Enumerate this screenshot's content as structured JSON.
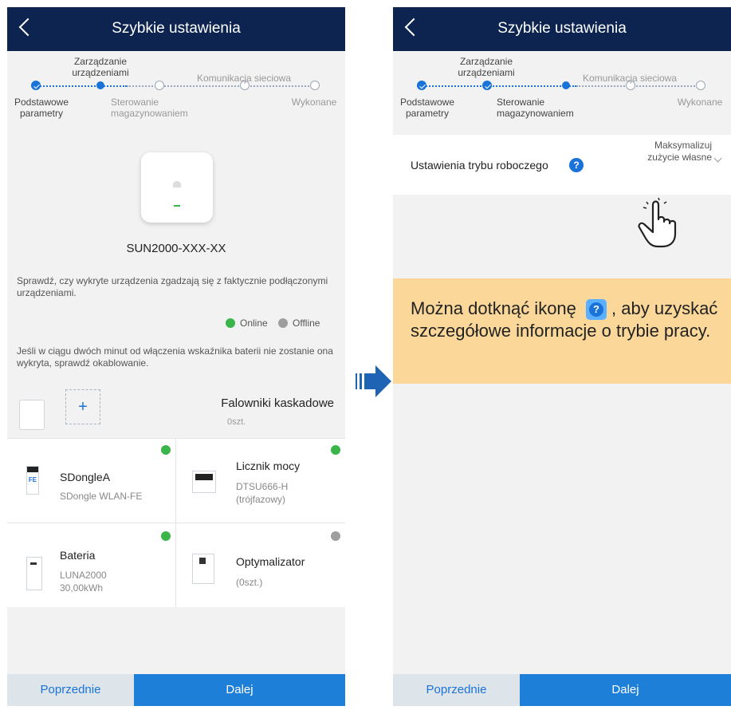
{
  "left": {
    "title": "Szybkie ustawienia",
    "steps": {
      "step1": "Podstawowe parametry",
      "step2": "Zarządzanie urządzeniami",
      "step3": "Sterowanie magazynowaniem",
      "step4": "Komunikacja sieciowa",
      "step5": "Wykonane"
    },
    "device_model": "SUN2000-XXX-XX",
    "verify_text": "Sprawdź, czy wykryte urządzenia zgadzają się z faktycznie podłączonymi urządzeniami.",
    "legend": {
      "online": "Online",
      "offline": "Offline"
    },
    "battery_note": "Jeśli w ciągu dwóch minut od włączenia wskaźnika baterii nie zostanie ona wykryta, sprawdź okablowanie.",
    "cascade": {
      "title": "Falowniki kaskadowe",
      "count": "0szt."
    },
    "devices": [
      {
        "name": "SDongleA",
        "sub": "SDongle WLAN-FE",
        "status": "online",
        "icon_text": "FE"
      },
      {
        "name": "Licznik mocy",
        "sub": "DTSU666-H (trójfazowy)",
        "status": "online"
      },
      {
        "name": "Bateria",
        "sub": "LUNA2000 30,00kWh",
        "status": "online"
      },
      {
        "name": "Optymalizator",
        "sub": "(0szt.)",
        "status": "offline"
      }
    ],
    "btn_prev": "Poprzednie",
    "btn_next": "Dalej"
  },
  "right": {
    "title": "Szybkie ustawienia",
    "steps": {
      "step1": "Podstawowe parametry",
      "step2": "Zarządzanie urządzeniami",
      "step3": "Sterowanie magazynowaniem",
      "step4": "Komunikacja sieciowa",
      "step5": "Wykonane"
    },
    "mode_label": "Ustawienia trybu roboczego",
    "mode_value": "Maksymalizuj zużycie własne",
    "hint_before": "Można dotknąć ikonę",
    "hint_after": ", aby uzyskać szczegółowe informacje o trybie pracy.",
    "btn_prev": "Poprzednie",
    "btn_next": "Dalej"
  },
  "colors": {
    "titlebar": "#0d2350",
    "accent": "#1a73d9",
    "online": "#39b54a",
    "offline": "#9e9e9e",
    "callout": "#fbd89a"
  }
}
